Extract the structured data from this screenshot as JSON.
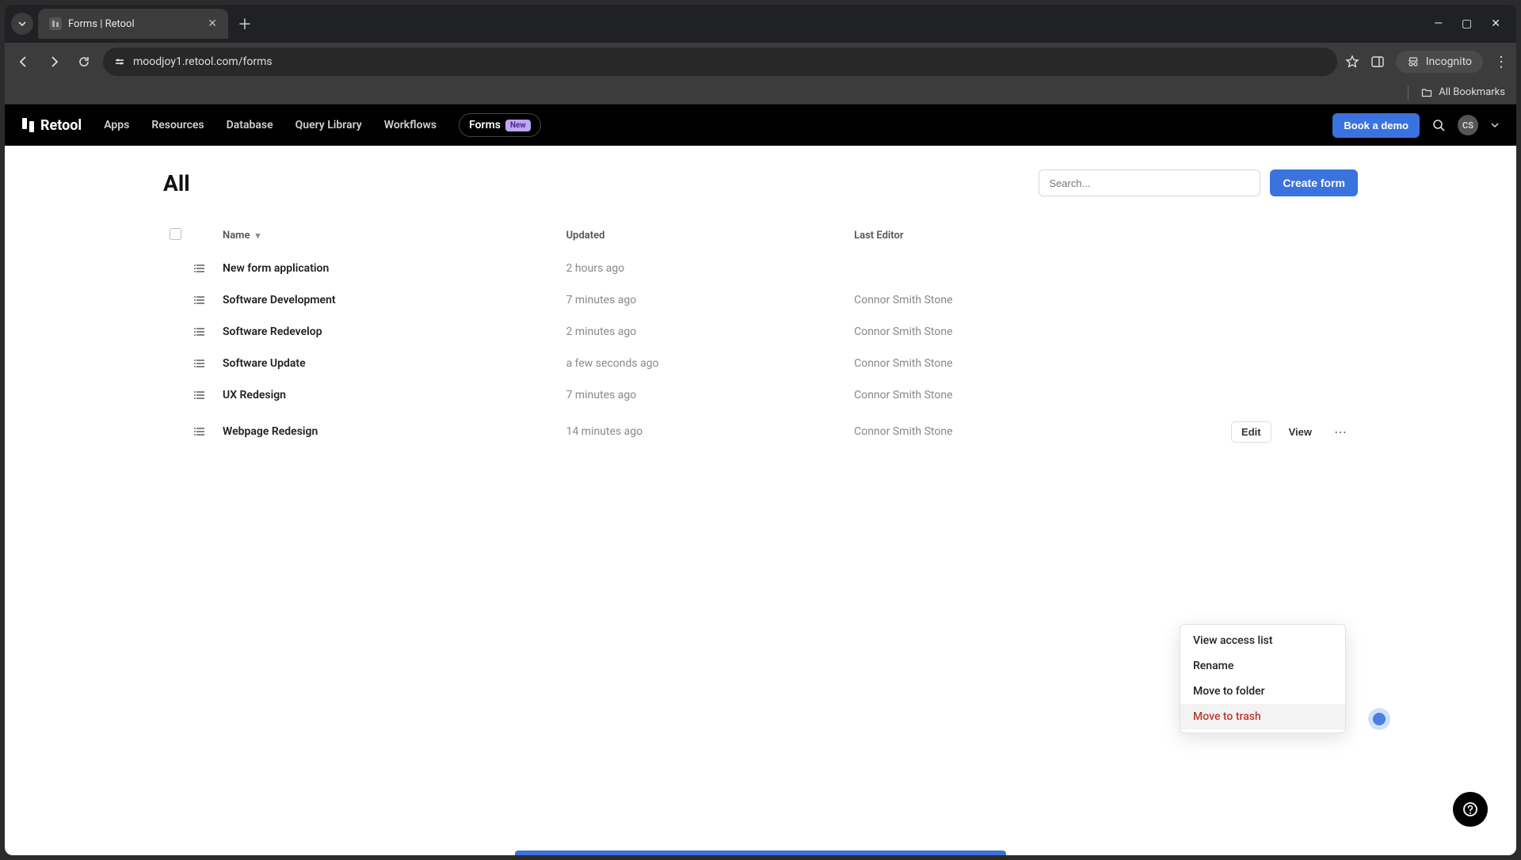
{
  "browser": {
    "tab_title": "Forms | Retool",
    "url": "moodjoy1.retool.com/forms",
    "incognito_label": "Incognito",
    "all_bookmarks": "All Bookmarks"
  },
  "appbar": {
    "brand": "Retool",
    "nav": {
      "apps": "Apps",
      "resources": "Resources",
      "database": "Database",
      "query_library": "Query Library",
      "workflows": "Workflows",
      "forms": "Forms",
      "forms_badge": "New"
    },
    "demo_button": "Book a demo",
    "avatar_initials": "CS"
  },
  "page": {
    "title": "All",
    "search_placeholder": "Search...",
    "create_button": "Create form"
  },
  "table": {
    "columns": {
      "name": "Name",
      "updated": "Updated",
      "last_editor": "Last Editor"
    },
    "rows": [
      {
        "name": "New form application",
        "updated": "2 hours ago",
        "editor": ""
      },
      {
        "name": "Software Development",
        "updated": "7 minutes ago",
        "editor": "Connor Smith Stone"
      },
      {
        "name": "Software Redevelop",
        "updated": "2 minutes ago",
        "editor": "Connor Smith Stone"
      },
      {
        "name": "Software Update",
        "updated": "a few seconds ago",
        "editor": "Connor Smith Stone"
      },
      {
        "name": "UX Redesign",
        "updated": "7 minutes ago",
        "editor": "Connor Smith Stone"
      },
      {
        "name": "Webpage Redesign",
        "updated": "14 minutes ago",
        "editor": "Connor Smith Stone"
      }
    ],
    "row_actions": {
      "edit": "Edit",
      "view": "View"
    }
  },
  "context_menu": {
    "view_access": "View access list",
    "rename": "Rename",
    "move_folder": "Move to folder",
    "move_trash": "Move to trash"
  }
}
